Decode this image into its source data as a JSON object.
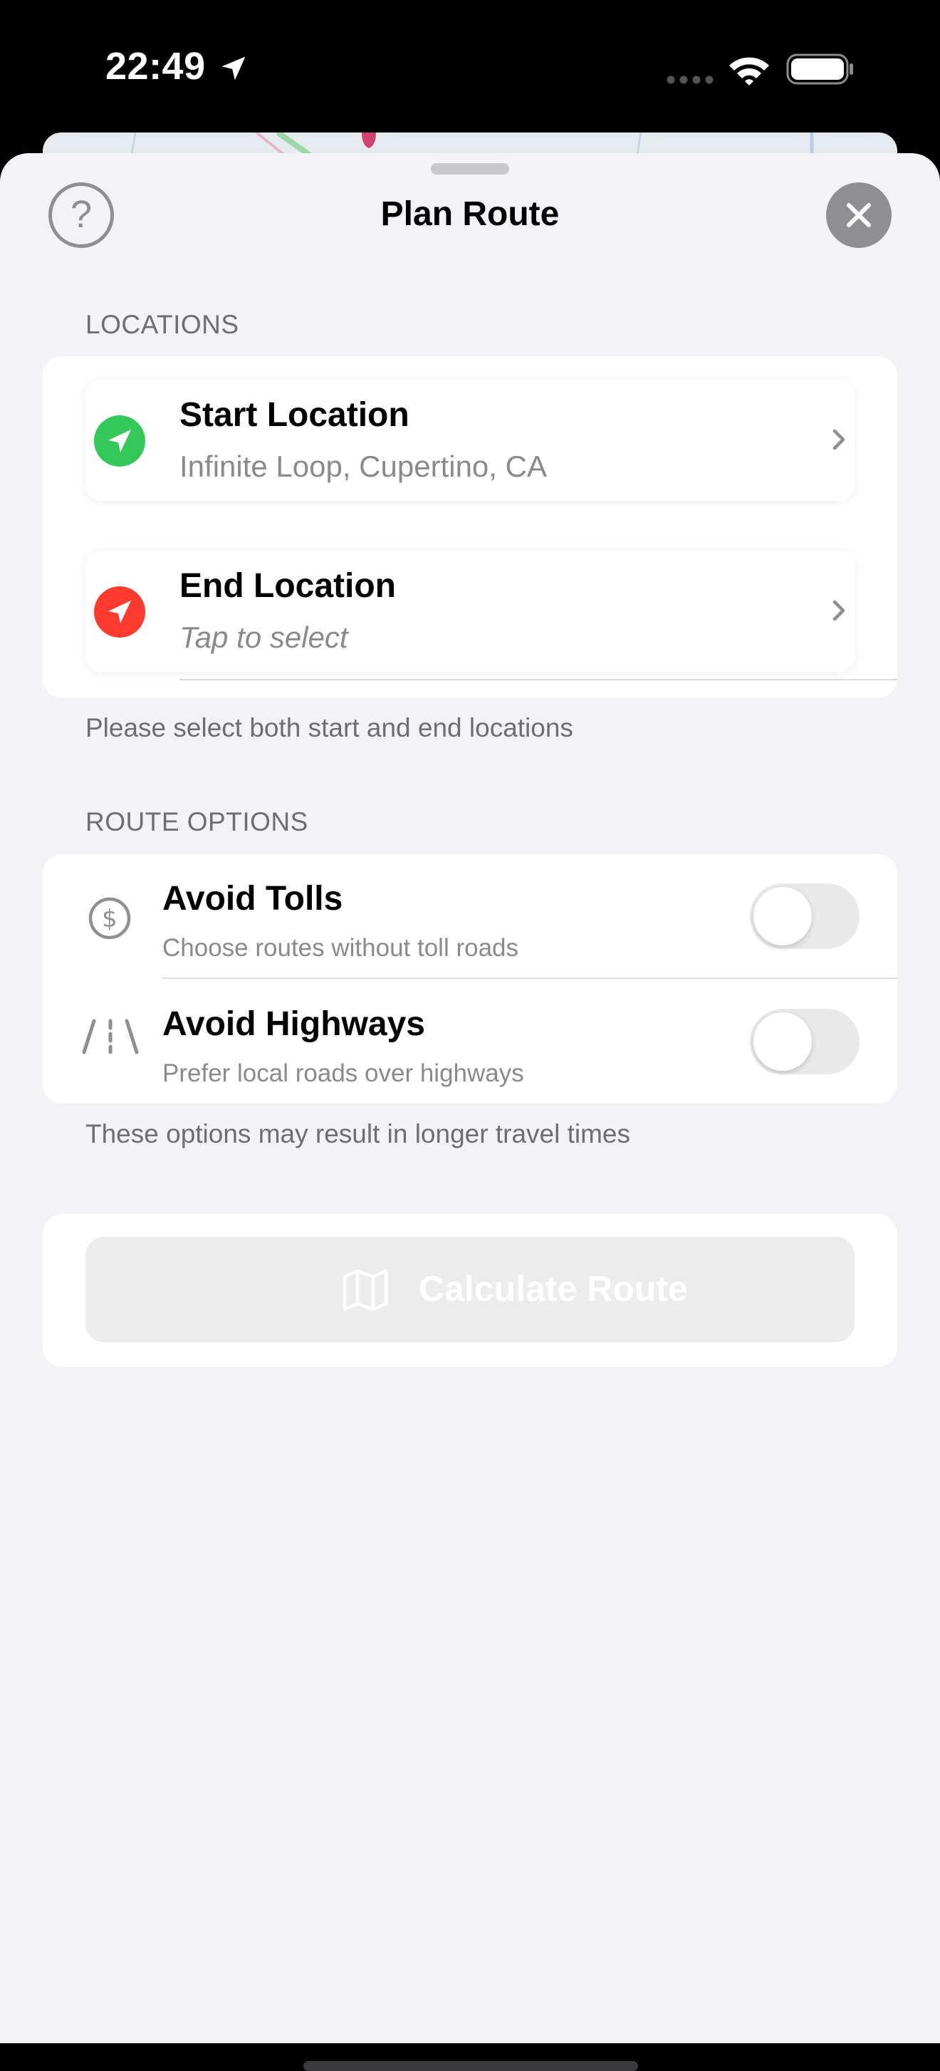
{
  "status_bar": {
    "time": "22:49"
  },
  "sheet": {
    "title": "Plan Route",
    "help_glyph": "?",
    "close_glyph": "✕"
  },
  "locations": {
    "header": "LOCATIONS",
    "start": {
      "title": "Start Location",
      "value": "Infinite Loop, Cupertino, CA",
      "icon": "location-arrow-icon",
      "color": "#34c759"
    },
    "end": {
      "title": "End Location",
      "value": "Tap to select",
      "icon": "location-arrow-icon",
      "color": "#ff3b30"
    },
    "footer": "Please select both start and end locations"
  },
  "route_options": {
    "header": "ROUTE OPTIONS",
    "options": [
      {
        "title": "Avoid Tolls",
        "subtitle": "Choose routes without toll roads",
        "icon": "dollar-circle-icon",
        "enabled": false
      },
      {
        "title": "Avoid Highways",
        "subtitle": "Prefer local roads over highways",
        "icon": "road-icon",
        "enabled": false
      }
    ],
    "footer": "These options may result in longer travel times"
  },
  "calculate": {
    "label": "Calculate Route",
    "icon": "map-icon",
    "disabled": true
  }
}
